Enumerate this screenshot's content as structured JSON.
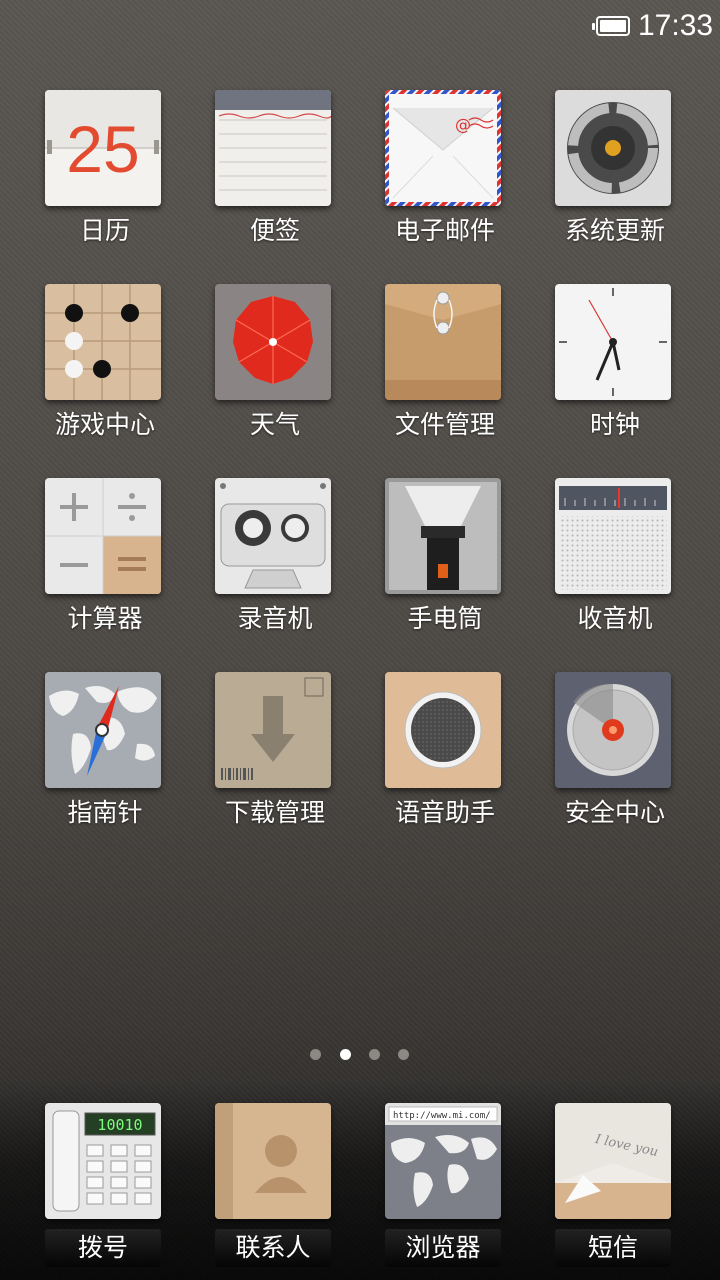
{
  "status_bar": {
    "time": "17:33"
  },
  "apps": [
    {
      "label": "日历",
      "icon": "calendar-icon",
      "date": "25"
    },
    {
      "label": "便签",
      "icon": "notes-icon"
    },
    {
      "label": "电子邮件",
      "icon": "email-icon"
    },
    {
      "label": "系统更新",
      "icon": "system-update-icon"
    },
    {
      "label": "游戏中心",
      "icon": "game-center-icon"
    },
    {
      "label": "天气",
      "icon": "weather-icon"
    },
    {
      "label": "文件管理",
      "icon": "file-manager-icon"
    },
    {
      "label": "时钟",
      "icon": "clock-icon"
    },
    {
      "label": "计算器",
      "icon": "calculator-icon"
    },
    {
      "label": "录音机",
      "icon": "recorder-icon"
    },
    {
      "label": "手电筒",
      "icon": "flashlight-icon"
    },
    {
      "label": "收音机",
      "icon": "radio-icon"
    },
    {
      "label": "指南针",
      "icon": "compass-icon"
    },
    {
      "label": "下载管理",
      "icon": "download-manager-icon"
    },
    {
      "label": "语音助手",
      "icon": "voice-assistant-icon"
    },
    {
      "label": "安全中心",
      "icon": "security-center-icon"
    }
  ],
  "page_indicator": {
    "count": 4,
    "active": 2
  },
  "dock": [
    {
      "label": "拨号",
      "icon": "phone-dialer-icon",
      "display": "10010"
    },
    {
      "label": "联系人",
      "icon": "contacts-icon"
    },
    {
      "label": "浏览器",
      "icon": "browser-icon",
      "url": "http://www.mi.com/"
    },
    {
      "label": "短信",
      "icon": "messages-icon",
      "note": "I love you"
    }
  ]
}
